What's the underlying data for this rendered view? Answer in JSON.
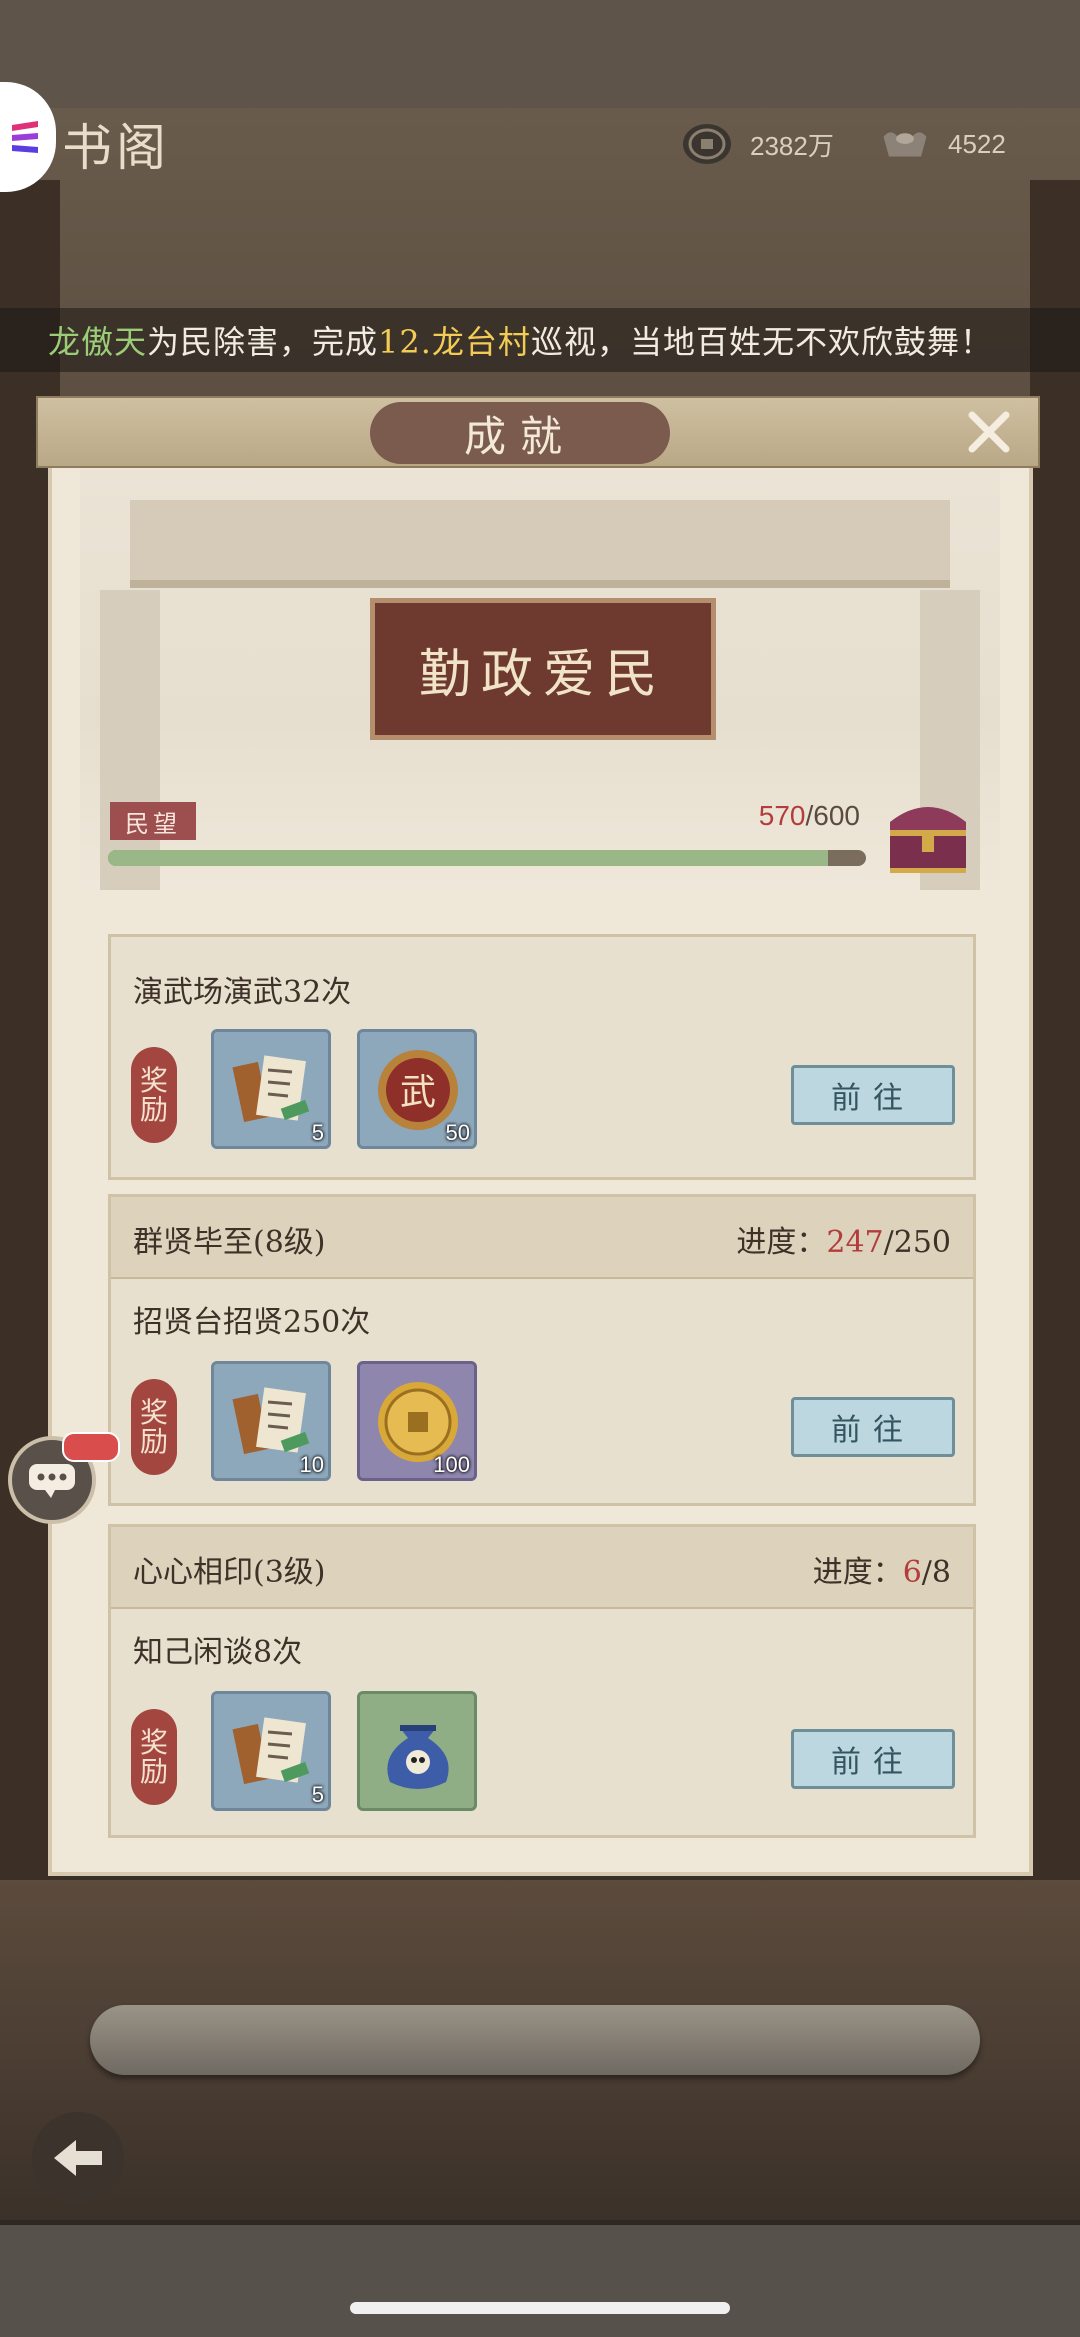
{
  "header": {
    "title": "书阁",
    "copper_coins": "2382万",
    "silver": "4522"
  },
  "marquee": {
    "player": "龙傲天",
    "text1": "为民除害，完成",
    "place": "12.龙台村",
    "text2": "巡视，当地百姓无不欢欣鼓舞！"
  },
  "panel": {
    "title": "成就",
    "sign": "勤政爱民",
    "reputation_label": "民望",
    "reputation_current": "570",
    "reputation_max": "/600",
    "reputation_fraction": 0.95
  },
  "tasks": [
    {
      "name": "",
      "progress_label": "",
      "progress_current": "",
      "progress_total": "",
      "description": "演武场演武32次",
      "reward_label_1": "奖",
      "reward_label_2": "励",
      "rewards": [
        {
          "icon": "scroll-book-icon",
          "qty": "5"
        },
        {
          "icon": "martial-coin-icon",
          "qty": "50"
        }
      ],
      "button": "前往"
    },
    {
      "name": "群贤毕至(8级)",
      "progress_label": "进度：",
      "progress_current": "247",
      "progress_total": "/250",
      "description": "招贤台招贤250次",
      "reward_label_1": "奖",
      "reward_label_2": "励",
      "rewards": [
        {
          "icon": "scroll-book-icon",
          "qty": "10"
        },
        {
          "icon": "gold-coin-icon",
          "qty": "100"
        }
      ],
      "button": "前往"
    },
    {
      "name": "心心相印(3级)",
      "progress_label": "进度：",
      "progress_current": "6",
      "progress_total": "/8",
      "description": "知己闲谈8次",
      "reward_label_1": "奖",
      "reward_label_2": "励",
      "rewards": [
        {
          "icon": "scroll-book-icon",
          "qty": "5"
        },
        {
          "icon": "pouch-icon",
          "qty": ""
        }
      ],
      "button": "前往"
    }
  ],
  "colors": {
    "accent_red": "#b33d3d",
    "bar_fill": "#9ab887",
    "button_blue": "#bcd7e0"
  }
}
